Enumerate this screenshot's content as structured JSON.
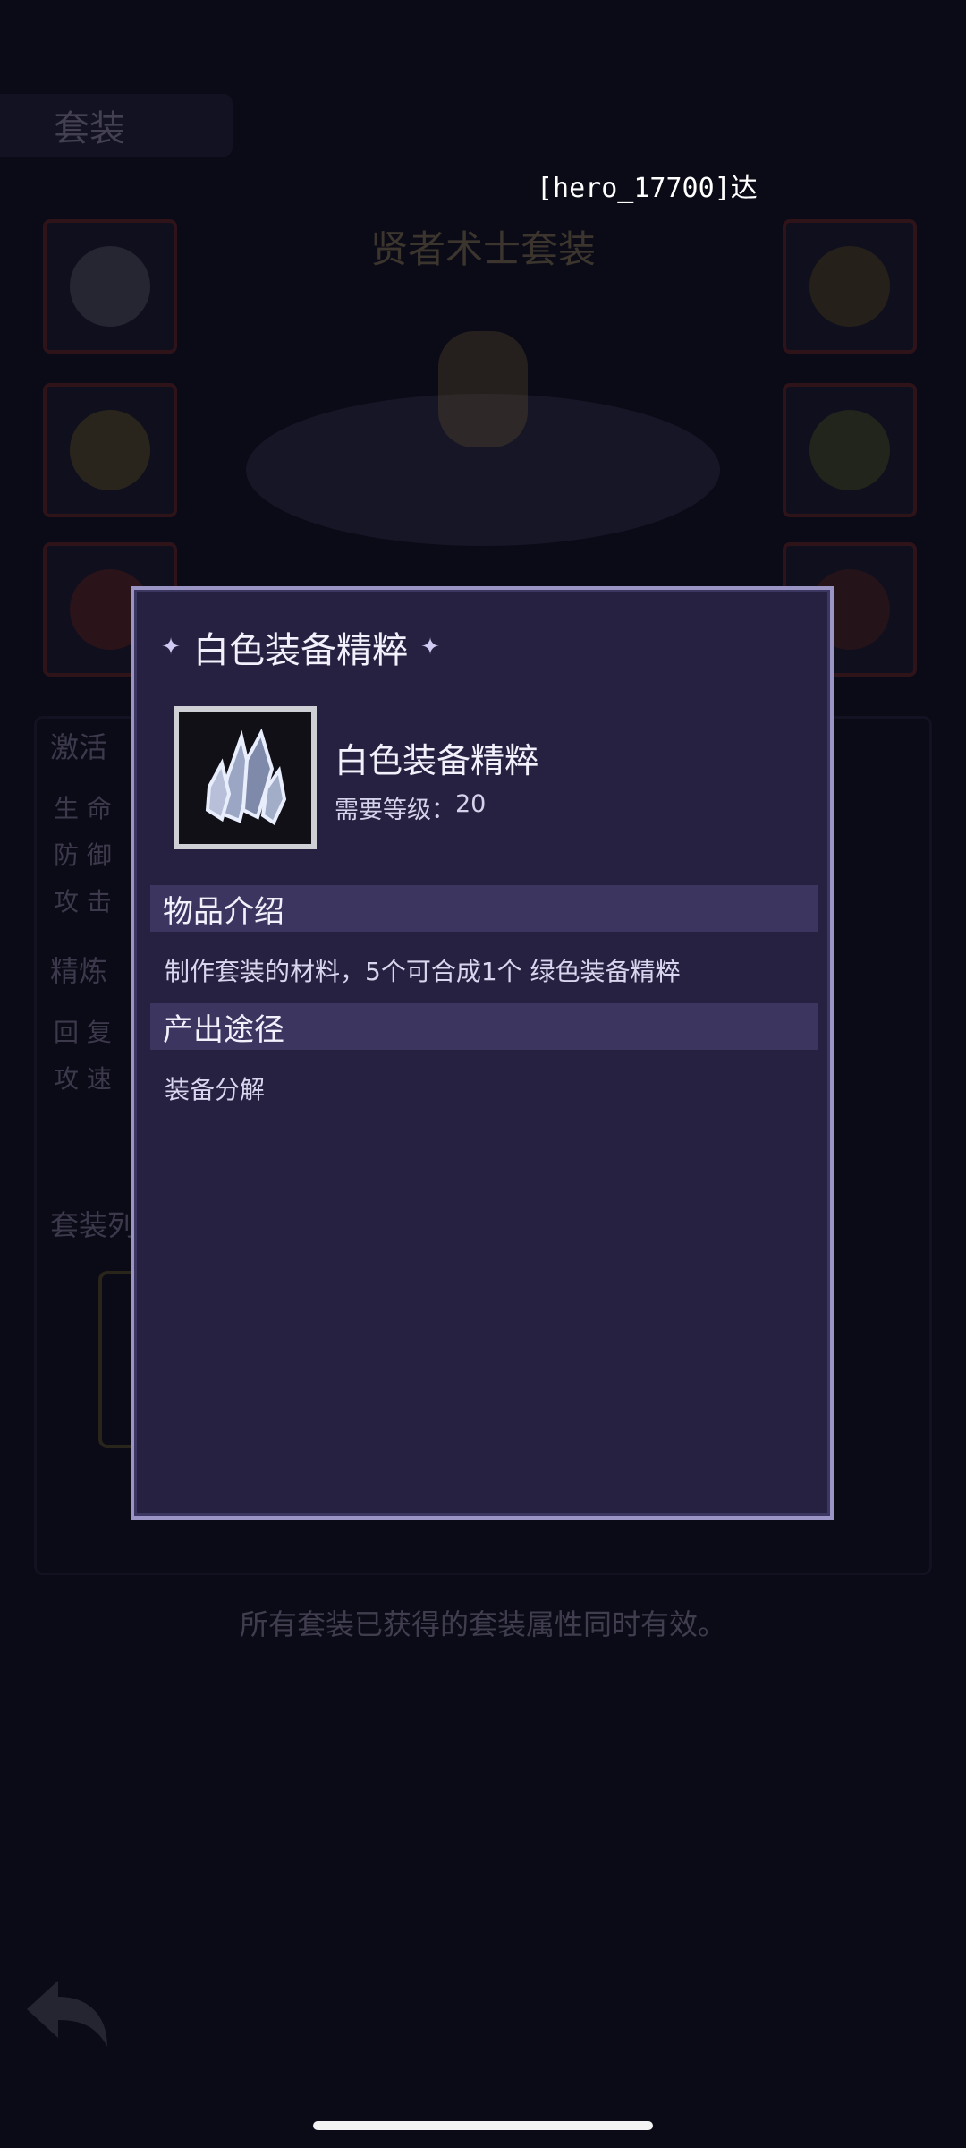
{
  "background": {
    "tab_title": "套装",
    "set_name": "贤者术士套装",
    "labels": [
      "激活",
      "生 命",
      "防 御",
      "攻 击",
      "精炼",
      "回 复",
      "攻 速",
      "套装列"
    ],
    "footer_note": "所有套装已获得的套装属性同时有效。"
  },
  "notice": {
    "text": "[hero_17700]达"
  },
  "modal": {
    "title": "白色装备精粹",
    "item": {
      "name": "白色装备精粹",
      "required_level_label": "需要等级：",
      "required_level": "20"
    },
    "sections": [
      {
        "title": "物品介绍",
        "text": "制作套装的材料，5个可合成1个 绿色装备精粹"
      },
      {
        "title": "产出途径",
        "text": "装备分解"
      }
    ]
  },
  "colors": {
    "modal_bg": "#262140",
    "modal_border": "#9b95c6",
    "section_bg": "#3b3560",
    "text_light": "#f1f0fb"
  },
  "icons": [
    "sparkle-icon",
    "crystal-icon",
    "back-arrow-icon"
  ]
}
